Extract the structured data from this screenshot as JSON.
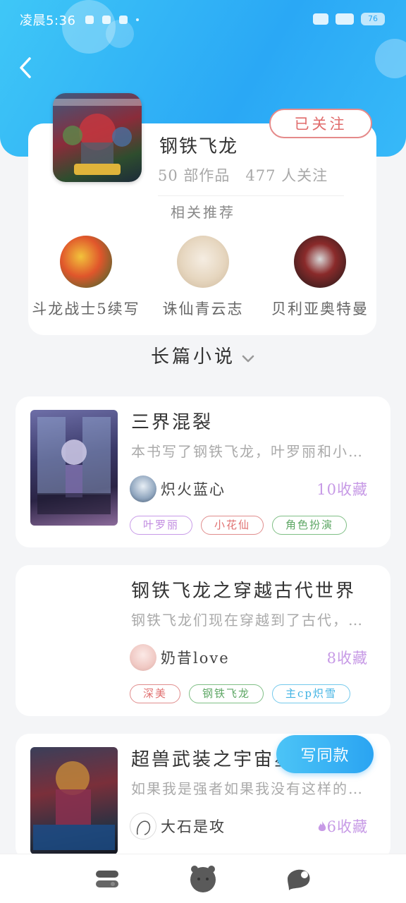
{
  "status_bar": {
    "time": "凌晨5:36",
    "battery": "76"
  },
  "topic": {
    "title": "钢铁飞龙",
    "works": "50 部作品",
    "followers": "477 人关注",
    "follow_button": "已关注",
    "related_title": "相关推荐"
  },
  "related": [
    {
      "name": "斗龙战士5续写"
    },
    {
      "name": "诛仙青云志"
    },
    {
      "name": "贝利亚奥特曼"
    }
  ],
  "section": {
    "label": "长篇小说"
  },
  "books": [
    {
      "title": "三界混裂",
      "desc": "本书写了钢铁飞龙，叶罗丽和小…",
      "author": "炽火蓝心",
      "favorites": "10收藏",
      "tags": [
        "叶罗丽",
        "小花仙",
        "角色扮演"
      ]
    },
    {
      "title": "钢铁飞龙之穿越古代世界",
      "desc": "钢铁飞龙们现在穿越到了古代，…",
      "author": "奶昔love",
      "favorites": "8收藏",
      "tags": [
        "深美",
        "钢铁飞龙",
        "主cp炽雪"
      ]
    },
    {
      "title": "超兽武装之宇宙星神",
      "desc": "如果我是强者如果我没有这样的…",
      "author": "大石是攻",
      "favorites": "6收藏"
    }
  ],
  "write_button": "写同款",
  "colors": {
    "accent": "#2aa8f5",
    "follow": "#e06b6b",
    "favorite": "#c79ae6"
  },
  "icons": {
    "back": "chevron-left-icon",
    "nav": [
      "home-icon",
      "bear-face-icon",
      "messages-icon"
    ]
  }
}
